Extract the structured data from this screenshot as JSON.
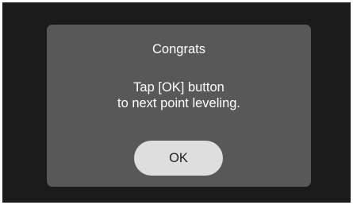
{
  "dialog": {
    "title": "Congrats",
    "message_lines": [
      "Tap [OK] button",
      "to next point leveling."
    ],
    "ok_label": "OK"
  }
}
